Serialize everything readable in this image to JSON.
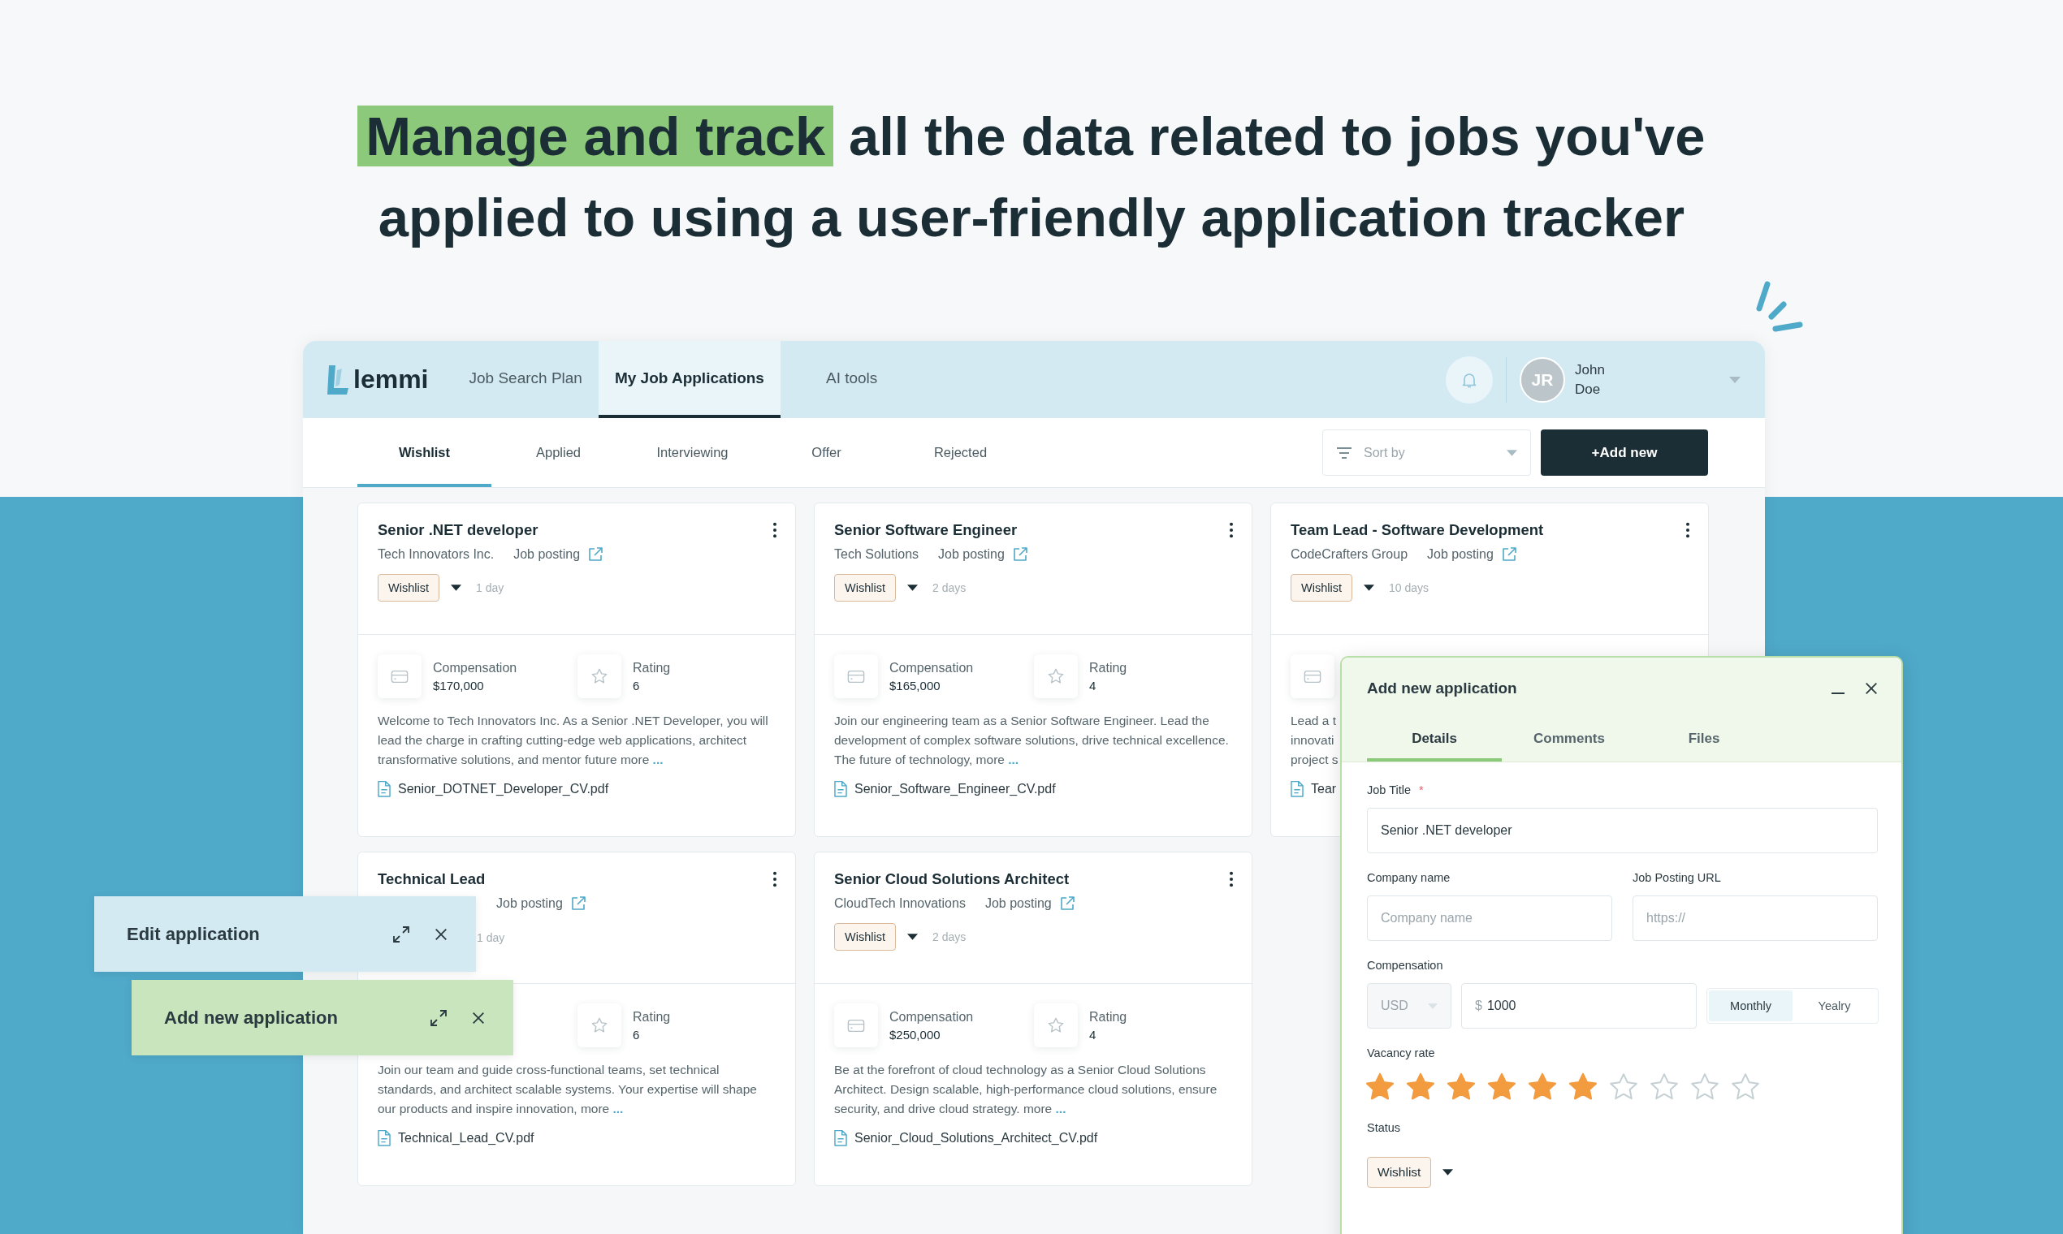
{
  "headline": {
    "highlight": "Manage and track",
    "rest": "all the data related to jobs you've applied to using a user-friendly application tracker"
  },
  "nav": {
    "logo": "lemmi",
    "tabs": [
      {
        "label": "Job Search Plan",
        "selected": false
      },
      {
        "label": "My Job Applications",
        "selected": true
      },
      {
        "label": "AI tools",
        "selected": false
      }
    ],
    "user": {
      "initials": "JR",
      "name": "John Doe"
    }
  },
  "status_tabs": [
    {
      "label": "Wishlist",
      "selected": true
    },
    {
      "label": "Applied",
      "selected": false
    },
    {
      "label": "Interviewing",
      "selected": false
    },
    {
      "label": "Offer",
      "selected": false
    },
    {
      "label": "Rejected",
      "selected": false
    }
  ],
  "sort": {
    "placeholder": "Sort by"
  },
  "add_button": "+Add new",
  "cards": [
    {
      "title": "Senior .NET developer",
      "company": "Tech Innovators Inc.",
      "posting": "Job posting",
      "status": "Wishlist",
      "age": "1 day",
      "compensation": {
        "label": "Compensation",
        "value": "$170,000"
      },
      "rating": {
        "label": "Rating",
        "value": "6"
      },
      "description": "Welcome to Tech Innovators Inc. As a Senior .NET Developer, you will lead the charge in crafting cutting-edge web applications, architect transformative solutions, and mentor future more",
      "more": "...",
      "file": "Senior_DOTNET_Developer_CV.pdf"
    },
    {
      "title": "Senior Software Engineer",
      "company": "Tech Solutions",
      "posting": "Job posting",
      "status": "Wishlist",
      "age": "2 days",
      "compensation": {
        "label": "Compensation",
        "value": "$165,000"
      },
      "rating": {
        "label": "Rating",
        "value": "4"
      },
      "description": "Join our engineering team as a Senior Software Engineer. Lead the development of complex software solutions, drive technical excellence. The future of technology, more",
      "more": "...",
      "file": "Senior_Software_Engineer_CV.pdf"
    },
    {
      "title": "Team Lead - Software Development",
      "company": "CodeCrafters Group",
      "posting": "Job posting",
      "status": "Wishlist",
      "age": "10 days",
      "compensation_tile": true,
      "description_lines": [
        "Lead a t",
        "innovati",
        "project s"
      ],
      "file": "Tear"
    },
    {
      "title": "Technical Lead",
      "posting": "Job posting",
      "age": "1 day",
      "rating": {
        "label": "Rating",
        "value": "6"
      },
      "description": "Join our team and guide cross-functional teams, set technical standards, and architect scalable systems. Your expertise will shape our products and inspire innovation, more",
      "more": "...",
      "file": "Technical_Lead_CV.pdf"
    },
    {
      "title": "Senior Cloud Solutions Architect",
      "company": "CloudTech Innovations",
      "posting": "Job posting",
      "status": "Wishlist",
      "age": "2 days",
      "compensation": {
        "label": "Compensation",
        "value": "$250,000"
      },
      "rating": {
        "label": "Rating",
        "value": "4"
      },
      "description": "Be at the forefront of cloud technology as a Senior Cloud Solutions Architect. Design scalable, high-performance cloud solutions, ensure security, and drive cloud strategy. more",
      "more": "...",
      "file": "Senior_Cloud_Solutions_Architect_CV.pdf"
    }
  ],
  "minimized_windows": [
    {
      "title": "Edit application",
      "color": "#d4eaf2"
    },
    {
      "title": "Add new application",
      "color": "#c8e5bd"
    }
  ],
  "modal": {
    "title": "Add new application",
    "tabs": [
      {
        "label": "Details",
        "selected": true
      },
      {
        "label": "Comments",
        "selected": false
      },
      {
        "label": "Files",
        "selected": false
      }
    ],
    "job_title": {
      "label": "Job Title",
      "required_mark": "*",
      "value": "Senior .NET developer"
    },
    "company": {
      "label": "Company name",
      "placeholder": "Company name"
    },
    "url": {
      "label": "Job Posting URL",
      "placeholder": "https://"
    },
    "compensation": {
      "label": "Compensation",
      "currency": "USD",
      "currency_disabled": true,
      "prefix": "$",
      "value": "1000",
      "periods": [
        {
          "label": "Monthly",
          "selected": true
        },
        {
          "label": "Yealry",
          "selected": false
        }
      ]
    },
    "vacancy": {
      "label": "Vacancy rate",
      "stars": 6
    },
    "status": {
      "label": "Status",
      "value": "Wishlist"
    }
  }
}
